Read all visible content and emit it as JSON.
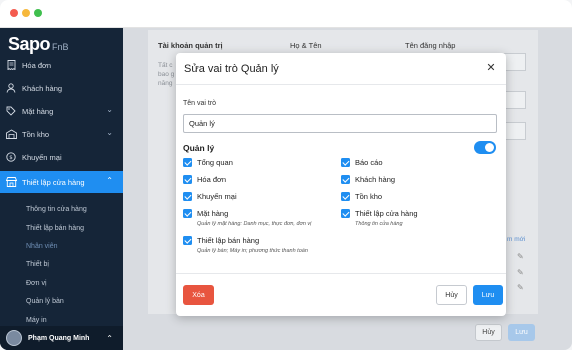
{
  "app": {
    "brand": "Sapo",
    "brand_sub": "FnB"
  },
  "sidebar": {
    "items": [
      {
        "label": "Hóa đơn",
        "icon": "receipt-icon"
      },
      {
        "label": "Khách hàng",
        "icon": "person-icon"
      },
      {
        "label": "Mặt hàng",
        "icon": "tag-icon"
      },
      {
        "label": "Tồn kho",
        "icon": "warehouse-icon"
      },
      {
        "label": "Khuyến mại",
        "icon": "discount-icon"
      },
      {
        "label": "Thiết lập cửa hàng",
        "icon": "store-icon"
      }
    ],
    "subitems": [
      "Thông tin cửa hàng",
      "Thiết lập bán hàng",
      "Nhân viên",
      "Thiết bị",
      "Đơn vị",
      "Quản lý bàn",
      "Máy in"
    ],
    "user": "Phạm Quang Minh"
  },
  "background": {
    "section_title": "Tài khoản quản trị",
    "desc_1": "Tất c",
    "desc_2": "bao g",
    "desc_3": "năng",
    "col_name": "Họ & Tên",
    "col_login": "Tên đăng nhập",
    "link": "m mới",
    "cancel": "Hủy",
    "save": "Lưu"
  },
  "modal": {
    "title": "Sửa vai trò Quản lý",
    "role_label": "Tên vai trò",
    "role_value": "Quản lý",
    "section": "Quản lý",
    "toggle_on": true,
    "perms_left": [
      {
        "label": "Tổng quan",
        "desc": ""
      },
      {
        "label": "Hóa đơn",
        "desc": ""
      },
      {
        "label": "Khuyến mại",
        "desc": ""
      },
      {
        "label": "Mặt hàng",
        "desc": "Quản lý mặt hàng: Danh mục, thực đơn, đơn vị"
      },
      {
        "label": "Thiết lập bán hàng",
        "desc": "Quản lý bàn; Máy in; phương thức thanh toán"
      }
    ],
    "perms_right": [
      {
        "label": "Báo cáo",
        "desc": ""
      },
      {
        "label": "Khách hàng",
        "desc": ""
      },
      {
        "label": "Tồn kho",
        "desc": ""
      },
      {
        "label": "Thiết lập cửa hàng",
        "desc": "Thông tin cửa hàng"
      }
    ],
    "delete": "Xóa",
    "cancel": "Hủy",
    "save": "Lưu"
  },
  "colors": {
    "accent": "#1f8ef1",
    "danger": "#e8553f",
    "sidebar": "#152538"
  }
}
